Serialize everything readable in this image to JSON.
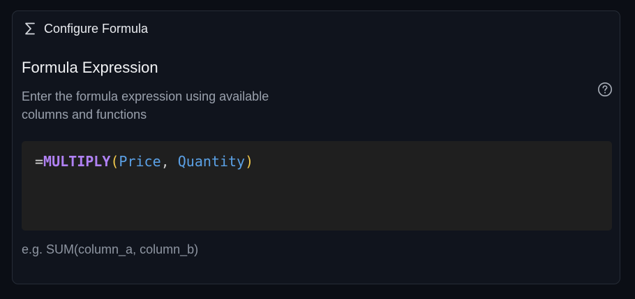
{
  "header": {
    "icon": "sigma-icon",
    "title": "Configure Formula"
  },
  "section": {
    "title": "Formula Expression",
    "description": "Enter the formula expression using available columns and functions",
    "help_icon": "help-circle-icon"
  },
  "editor": {
    "tokens": {
      "prefix": "=",
      "function": "MULTIPLY",
      "open_paren": "(",
      "arg1": "Price",
      "comma": ", ",
      "arg2": "Quantity",
      "close_paren": ")"
    },
    "colors": {
      "function": "#b081f3",
      "paren": "#f2c94c",
      "argument": "#5ba1e6",
      "background": "#1f1f1f"
    }
  },
  "hint": {
    "text": "e.g. SUM(column_a, column_b)"
  }
}
